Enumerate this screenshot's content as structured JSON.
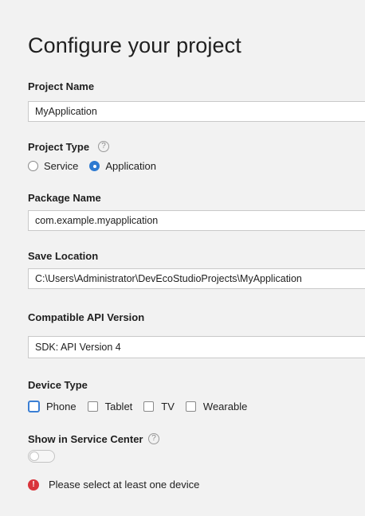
{
  "page": {
    "title": "Configure your project"
  },
  "project_name": {
    "label": "Project Name",
    "value": "MyApplication"
  },
  "project_type": {
    "label": "Project Type",
    "help_icon": "question-circle-icon",
    "options": [
      {
        "label": "Service",
        "selected": false
      },
      {
        "label": "Application",
        "selected": true
      }
    ]
  },
  "package_name": {
    "label": "Package Name",
    "value": "com.example.myapplication"
  },
  "save_location": {
    "label": "Save Location",
    "value": "C:\\Users\\Administrator\\DevEcoStudioProjects\\MyApplication"
  },
  "api_version": {
    "label": "Compatible API Version",
    "value": "SDK: API Version 4"
  },
  "device_type": {
    "label": "Device Type",
    "options": [
      {
        "label": "Phone",
        "checked": false,
        "focused": true
      },
      {
        "label": "Tablet",
        "checked": false
      },
      {
        "label": "TV",
        "checked": false
      },
      {
        "label": "Wearable",
        "checked": false
      }
    ]
  },
  "service_center": {
    "label": "Show in Service Center",
    "help_icon": "question-circle-icon",
    "enabled": false
  },
  "error": {
    "icon": "error-icon",
    "message": "Please select at least one device",
    "color": "#d9343b"
  },
  "colors": {
    "accent": "#2e7ad1",
    "background": "#f2f2f2"
  }
}
